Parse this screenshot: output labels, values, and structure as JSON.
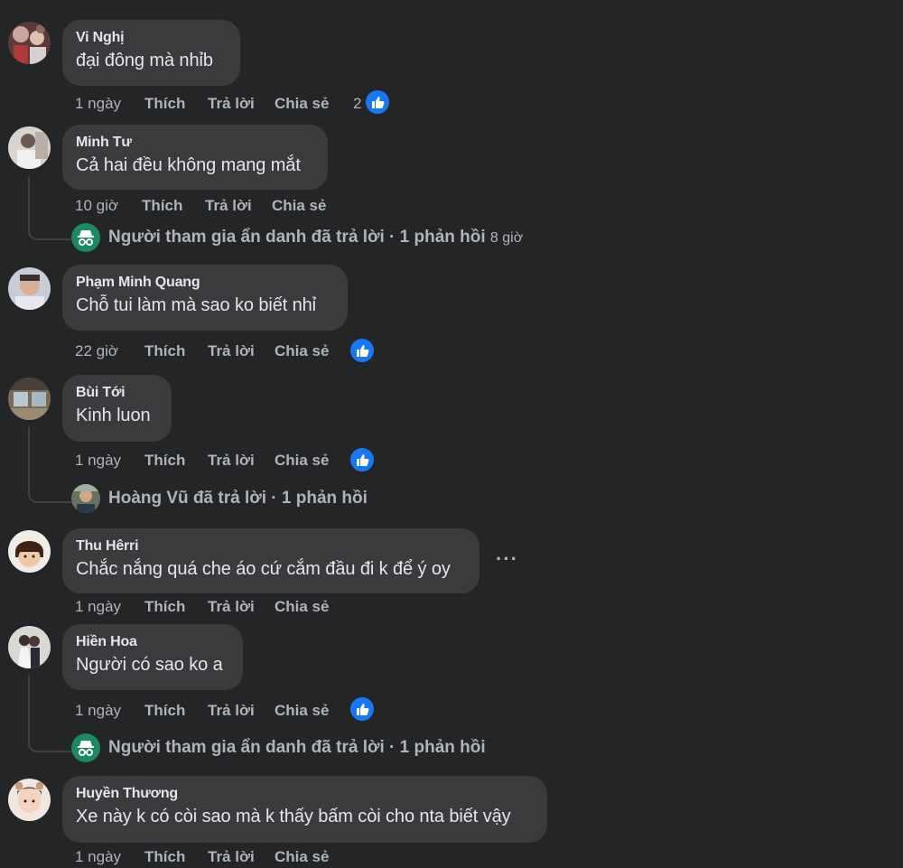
{
  "comments": [
    {
      "author": "Vi Nghị",
      "text": "đại đông mà nhỉb",
      "time": "1 ngày",
      "like_count": "2"
    },
    {
      "author": "Minh Tư",
      "text": "Cả hai đều không mang mắt",
      "time": "10 giờ",
      "reply": {
        "text": "Người tham gia ẩn danh đã trả lời · 1 phản hồi",
        "time": "8 giờ",
        "icon": "incognito-icon"
      }
    },
    {
      "author": "Phạm Minh Quang",
      "text": "Chỗ tui làm mà sao ko biết nhỉ",
      "time": "22 giờ"
    },
    {
      "author": "Bùi Tới",
      "text": "Kinh luon",
      "time": "1 ngày",
      "reply": {
        "text": "Hoàng Vũ đã trả lời · 1 phản hồi"
      }
    },
    {
      "author": "Thu Hêrri",
      "text": "Chắc nắng quá che áo cứ cắm đầu đi k để ý oy",
      "time": "1 ngày",
      "more": "···"
    },
    {
      "author": "Hiền Hoa",
      "text": "Người có sao ko a",
      "time": "1 ngày",
      "reply": {
        "text": "Người tham gia ẩn danh đã trả lời · 1 phản hồi",
        "icon": "incognito-icon"
      }
    },
    {
      "author": "Huyền Thương",
      "text": "Xe này k có còi sao mà k thấy bấm còi cho nta biết vậy",
      "time": "1 ngày"
    }
  ],
  "actions": {
    "like": "Thích",
    "reply": "Trả lời",
    "share": "Chia sẻ"
  },
  "colors": {
    "background": "#242526",
    "bubble": "#3a3b3c",
    "text_primary": "#e4e6eb",
    "text_secondary": "#b0b3b8",
    "like_blue": "#1877f2",
    "incognito_green": "#1c8a61"
  }
}
